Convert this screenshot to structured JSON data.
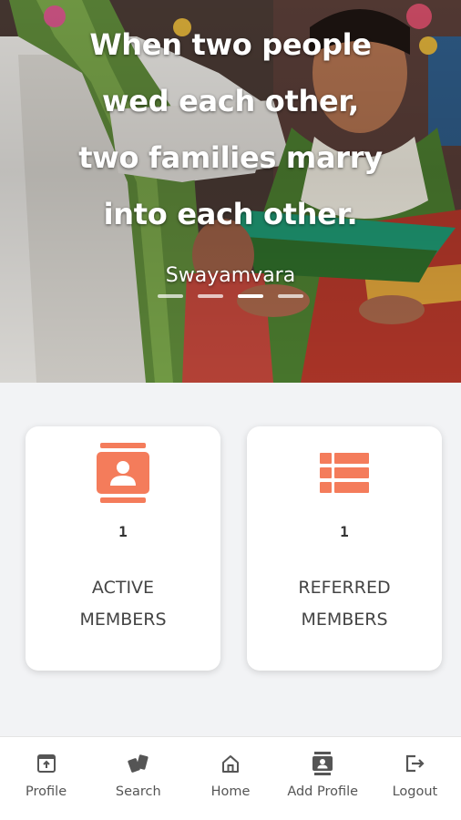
{
  "hero": {
    "quote_lines": [
      "When two people",
      "wed each other,",
      "two families marry",
      "into each other."
    ],
    "brand": "Swayamvara",
    "slides": 4,
    "active_slide": 3
  },
  "stats": {
    "active_members": {
      "count": "1",
      "label_line1": "ACTIVE",
      "label_line2": "MEMBERS",
      "icon": "contact-book-icon"
    },
    "referred_members": {
      "count": "1",
      "label_line1": "REFERRED",
      "label_line2": "MEMBERS",
      "icon": "list-icon"
    }
  },
  "nav": [
    {
      "label": "Profile",
      "icon": "profile-icon"
    },
    {
      "label": "Search",
      "icon": "search-cards-icon"
    },
    {
      "label": "Home",
      "icon": "home-icon"
    },
    {
      "label": "Add Profile",
      "icon": "add-profile-icon"
    },
    {
      "label": "Logout",
      "icon": "logout-icon"
    }
  ],
  "colors": {
    "accent": "#f47c5b",
    "background": "#f2f3f5",
    "nav_icon": "#555555"
  }
}
